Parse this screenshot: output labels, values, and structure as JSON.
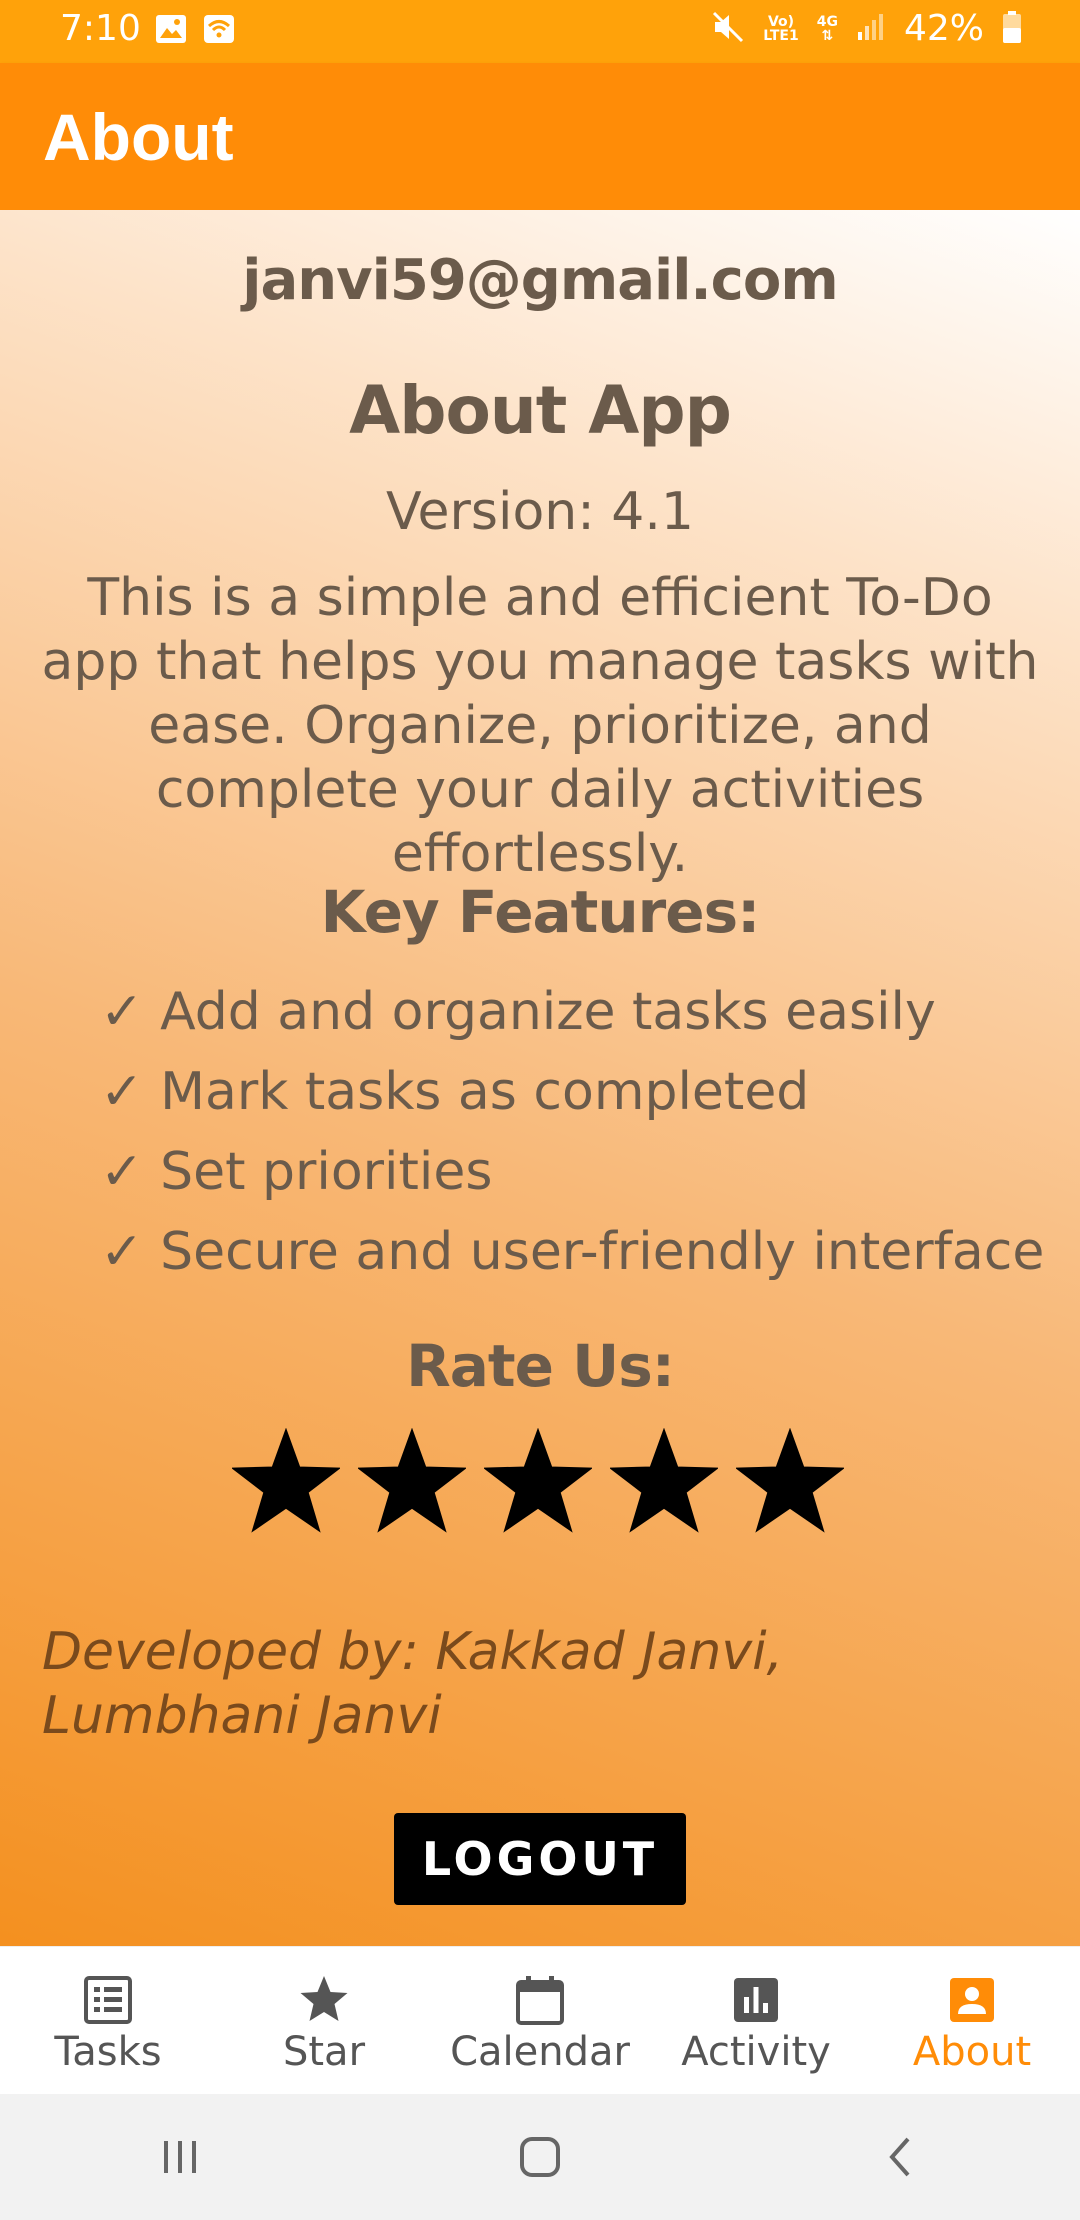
{
  "status_bar": {
    "time": "7:10",
    "net_top": "Vo)",
    "net_bottom": "LTE1",
    "net_4g": "4G",
    "battery": "42%"
  },
  "app_bar": {
    "title": "About"
  },
  "content": {
    "email": "janvi59@gmail.com",
    "about_heading": "About App",
    "version": "Version: 4.1",
    "description": "This is a simple and efficient To-Do app that helps you manage tasks with ease. Organize, prioritize, and complete your daily activities effortlessly.",
    "features_heading": "Key Features:",
    "features": [
      "✓ Add and organize tasks easily",
      "✓ Mark tasks as completed",
      "✓ Set priorities",
      "✓ Secure and user-friendly interface"
    ],
    "rate_heading": "Rate Us:",
    "rating": {
      "filled": 5,
      "total": 5
    },
    "developed_by": "Developed by: Kakkad Janvi, Lumbhani Janvi",
    "logout_label": "LOGOUT"
  },
  "bottom_nav": {
    "items": [
      {
        "label": "Tasks",
        "icon": "list-icon"
      },
      {
        "label": "Star",
        "icon": "star-icon"
      },
      {
        "label": "Calendar",
        "icon": "calendar-icon"
      },
      {
        "label": "Activity",
        "icon": "bar-chart-icon"
      },
      {
        "label": "About",
        "icon": "person-icon"
      }
    ],
    "active_index": 4
  },
  "colors": {
    "status_bar": "#ffa20a",
    "app_bar": "#ff8c07",
    "active_nav": "#ff8c07",
    "text": "#6b5b4b"
  }
}
